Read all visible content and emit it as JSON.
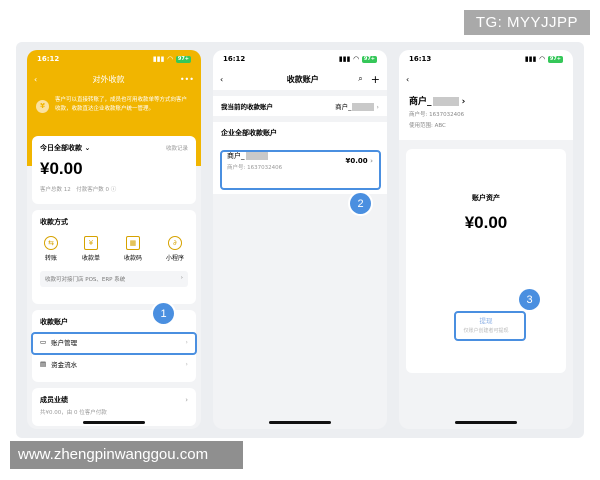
{
  "watermark_top": "TG: MYYJJPP",
  "watermark_bottom": "www.zhengpinwanggou.com",
  "colors": {
    "accent": "#f1b500",
    "highlight": "#4a8fe0"
  },
  "phone1": {
    "time": "16:12",
    "battery": "97+",
    "title": "对外收款",
    "notice": "客户可以直接转账了，成员也可用收款单等方式向客户收款，收款直达企业收款账户统一管理。",
    "today_label": "今日全部收款",
    "today_link": "收款记录",
    "amount": "¥0.00",
    "stats": "客户总数 12　付款客户数 0",
    "methods_title": "收款方式",
    "methods": [
      {
        "label": "转账",
        "icon": "transfer-icon",
        "glyph": "⇆"
      },
      {
        "label": "收款单",
        "icon": "receipt-icon",
        "glyph": "¥"
      },
      {
        "label": "收款码",
        "icon": "qrcode-icon",
        "glyph": "▦"
      },
      {
        "label": "小程序",
        "icon": "miniprogram-icon",
        "glyph": "∂"
      }
    ],
    "tip": "收款可对接门店 POS、ERP 系统",
    "accounts_title": "收款账户",
    "items": [
      {
        "label": "账户管理",
        "icon": "card-icon",
        "glyph": "▭"
      },
      {
        "label": "资金流水",
        "icon": "document-icon",
        "glyph": "▤"
      }
    ],
    "perf_title": "成员业绩",
    "perf_sub": "共¥0.00，由 0 位客户付款",
    "badge": "1"
  },
  "phone2": {
    "time": "16:12",
    "battery": "97+",
    "title": "收款账户",
    "current_label": "我当前的收款账户",
    "current_value": "商户_",
    "all_label": "企业全部收款账户",
    "account_name": "商户_",
    "account_no": "商户号: 1637032406",
    "account_amount": "¥0.00",
    "badge": "2"
  },
  "phone3": {
    "time": "16:13",
    "battery": "97+",
    "merchant": "商户_",
    "merchant_no": "商户号: 1637032406",
    "scope": "使用范围: ABC",
    "assets_label": "账户资产",
    "amount": "¥0.00",
    "withdraw": "提现",
    "withdraw_sub": "仅账户创建者可提现",
    "badge": "3"
  }
}
